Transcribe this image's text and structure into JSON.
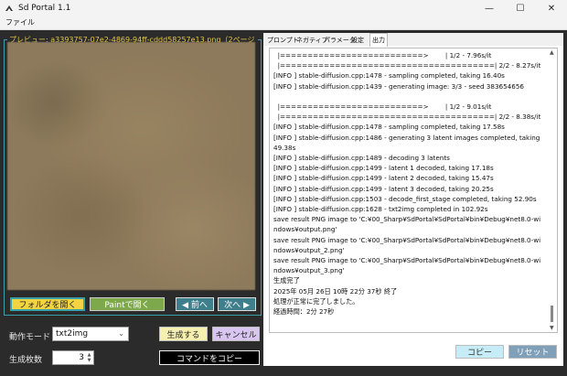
{
  "window": {
    "title": "Sd Portal 1.1",
    "minimize": "—",
    "maximize": "☐",
    "close": "✕"
  },
  "menu": {
    "file": "ファイル"
  },
  "preview": {
    "label": "プレビュー: a3393757-07e2-4869-94ff-cddd58257e13.png（2ページ"
  },
  "buttons": {
    "open_folder": "フォルダを開く",
    "open_paint": "Paintで開く",
    "prev": "◀ 前へ",
    "next": "次へ ▶",
    "generate": "生成する",
    "cancel": "キャンセル",
    "copy_command": "コマンドをコピー",
    "copy": "コピー",
    "reset": "リセット"
  },
  "form": {
    "mode_label": "動作モード",
    "mode_value": "txt2img",
    "count_label": "生成枚数",
    "count_value": "3"
  },
  "tabs": [
    "プロンプト",
    "ネガティブ",
    "パラメータ",
    "設定",
    "出力"
  ],
  "output_log": "  |==========================>        | 1/2 - 7.96s/it\n  |=======================================| 2/2 - 8.27s/it\n[INFO ] stable-diffusion.cpp:1478 - sampling completed, taking 16.40s\n[INFO ] stable-diffusion.cpp:1439 - generating image: 3/3 - seed 383654656\n\n  |==========================>        | 1/2 - 9.01s/it\n  |=======================================| 2/2 - 8.38s/it\n[INFO ] stable-diffusion.cpp:1478 - sampling completed, taking 17.58s\n[INFO ] stable-diffusion.cpp:1486 - generating 3 latent images completed, taking 49.38s\n[INFO ] stable-diffusion.cpp:1489 - decoding 3 latents\n[INFO ] stable-diffusion.cpp:1499 - latent 1 decoded, taking 17.18s\n[INFO ] stable-diffusion.cpp:1499 - latent 2 decoded, taking 15.47s\n[INFO ] stable-diffusion.cpp:1499 - latent 3 decoded, taking 20.25s\n[INFO ] stable-diffusion.cpp:1503 - decode_first_stage completed, taking 52.90s\n[INFO ] stable-diffusion.cpp:1628 - txt2img completed in 102.92s\nsave result PNG image to 'C:¥00_Sharp¥SdPortal¥SdPortal¥bin¥Debug¥net8.0-windows¥output.png'\nsave result PNG image to 'C:¥00_Sharp¥SdPortal¥SdPortal¥bin¥Debug¥net8.0-windows¥output_2.png'\nsave result PNG image to 'C:¥00_Sharp¥SdPortal¥SdPortal¥bin¥Debug¥net8.0-windows¥output_3.png'\n生成完了\n2025年 05月 26日 10時 22分 37秒 終了\n処理が正常に完了しました。\n経過時間：2分 27秒",
  "colors": {
    "background": "#2b2b2b",
    "accent_teal": "#3aa0a8",
    "preview_label": "#e6c84a"
  }
}
